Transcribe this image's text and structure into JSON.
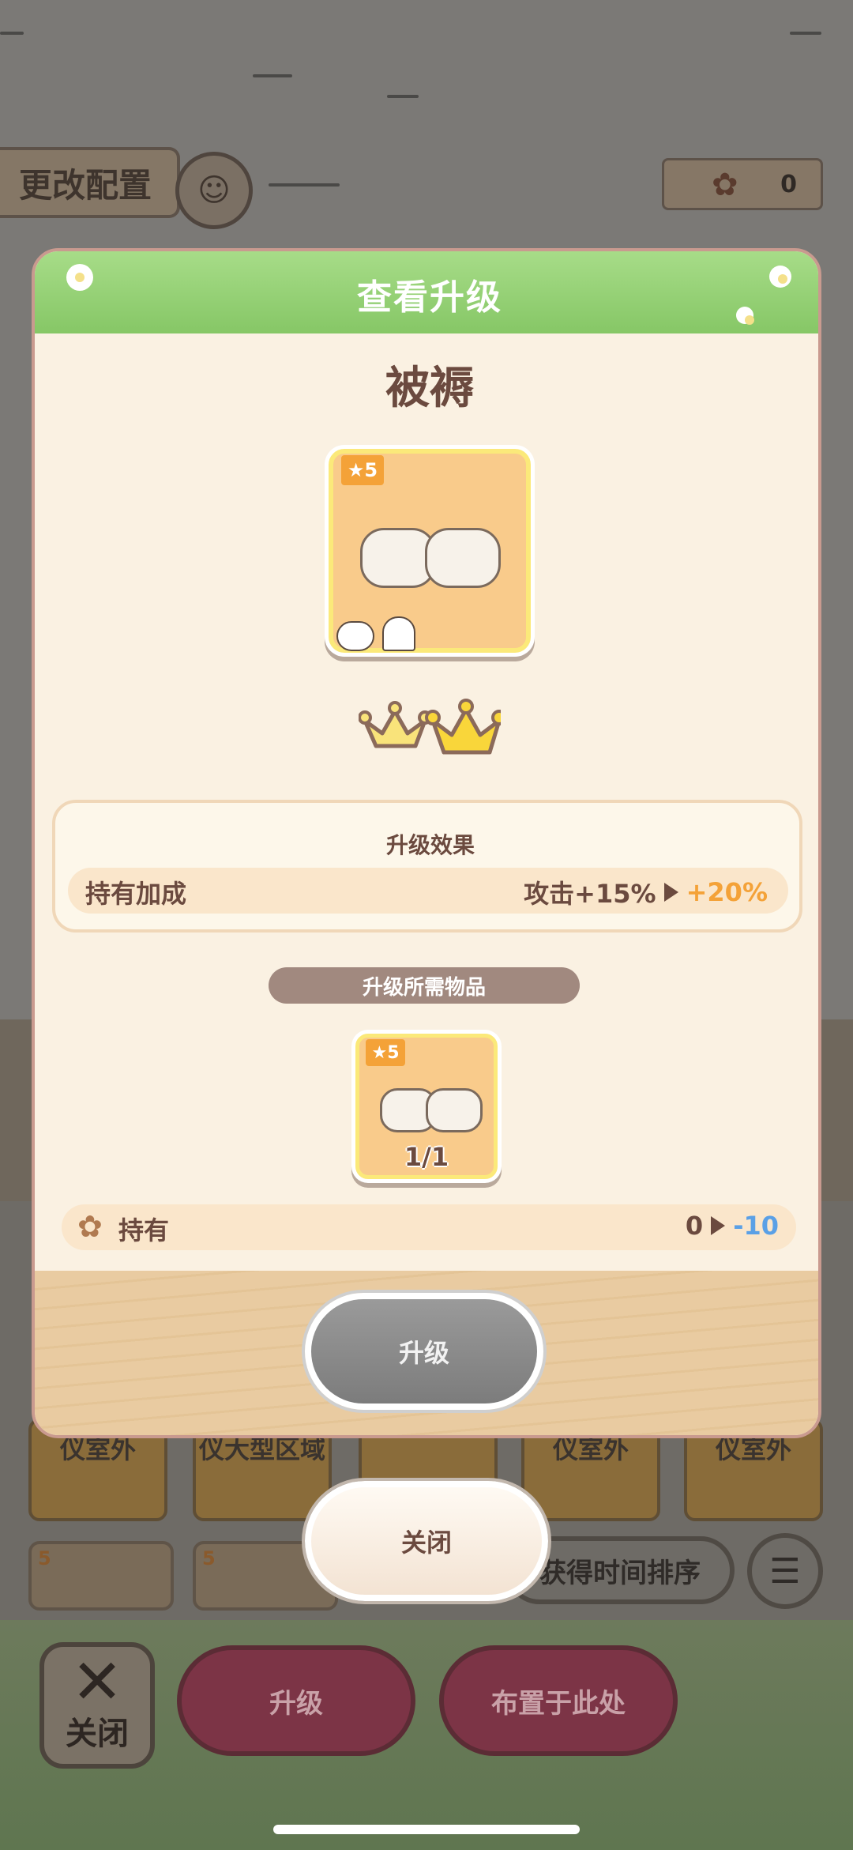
{
  "background": {
    "config_button": "更改配置",
    "resource_count": "0",
    "grid_cards": [
      "仪室外",
      "仪大型区域",
      "仪室外",
      "仪室外"
    ],
    "grid_badges": [
      "5",
      "5"
    ],
    "sort_button": "获得时间排序",
    "bottom_close_label": "关闭",
    "bottom_upgrade_label": "升级",
    "bottom_place_label": "布置于此处"
  },
  "modal": {
    "title": "查看升级",
    "item_name": "被褥",
    "item_stars": "5",
    "crowns_filled": 2,
    "effect": {
      "title": "升级效果",
      "label": "持有加成",
      "current": "攻击+15%",
      "next": "+20%",
      "next_color": "#f4a238"
    },
    "requirement": {
      "title": "升级所需物品",
      "stars": "5",
      "count": "1/1"
    },
    "owned": {
      "label": "持有",
      "current": "0",
      "next": "-10",
      "next_color": "#5aa0e6"
    },
    "upgrade_button": "升级",
    "close_button": "关闭"
  }
}
